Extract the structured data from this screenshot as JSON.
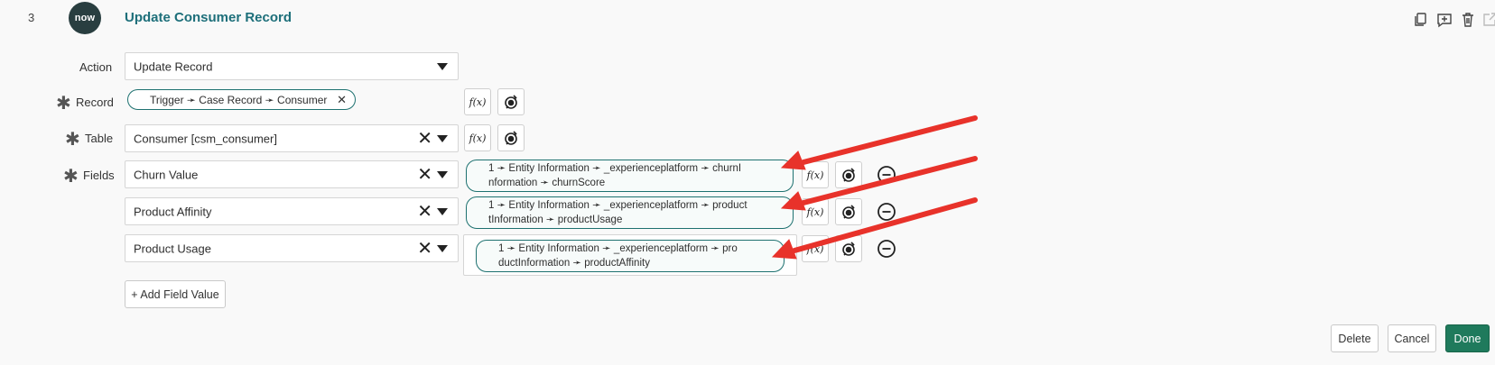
{
  "step": {
    "number": "3",
    "logo_text": "now",
    "title": "Update Consumer Record"
  },
  "action": {
    "label": "Action",
    "value": "Update Record"
  },
  "record": {
    "label": "Record",
    "pill": "Trigger ➛ Case Record ➛ Consumer"
  },
  "table": {
    "label": "Table",
    "value": "Consumer [csm_consumer]"
  },
  "fields": {
    "label": "Fields",
    "rows": [
      {
        "field": "Churn Value",
        "value_line1": "1 ➛ Entity Information ➛ _experienceplatform ➛ churnI",
        "value_line2": "nformation ➛ churnScore"
      },
      {
        "field": "Product Affinity",
        "value_line1": "1 ➛ Entity Information ➛ _experienceplatform ➛ product",
        "value_line2": "tInformation ➛ productUsage"
      },
      {
        "field": "Product Usage",
        "value_line1": "1 ➛ Entity Information ➛ _experienceplatform ➛ pro",
        "value_line2": "ductInformation ➛ productAffinity"
      }
    ]
  },
  "icons": {
    "fx": "f(x)",
    "clear": "✕"
  },
  "add_field_label": "+ Add Field Value",
  "footer": {
    "delete": "Delete",
    "cancel": "Cancel",
    "done": "Done"
  },
  "colors": {
    "accent": "#1d6f7a",
    "pill_border": "#1e7170",
    "primary": "#1f7a5c",
    "annotation_arrow": "#e8322a"
  }
}
